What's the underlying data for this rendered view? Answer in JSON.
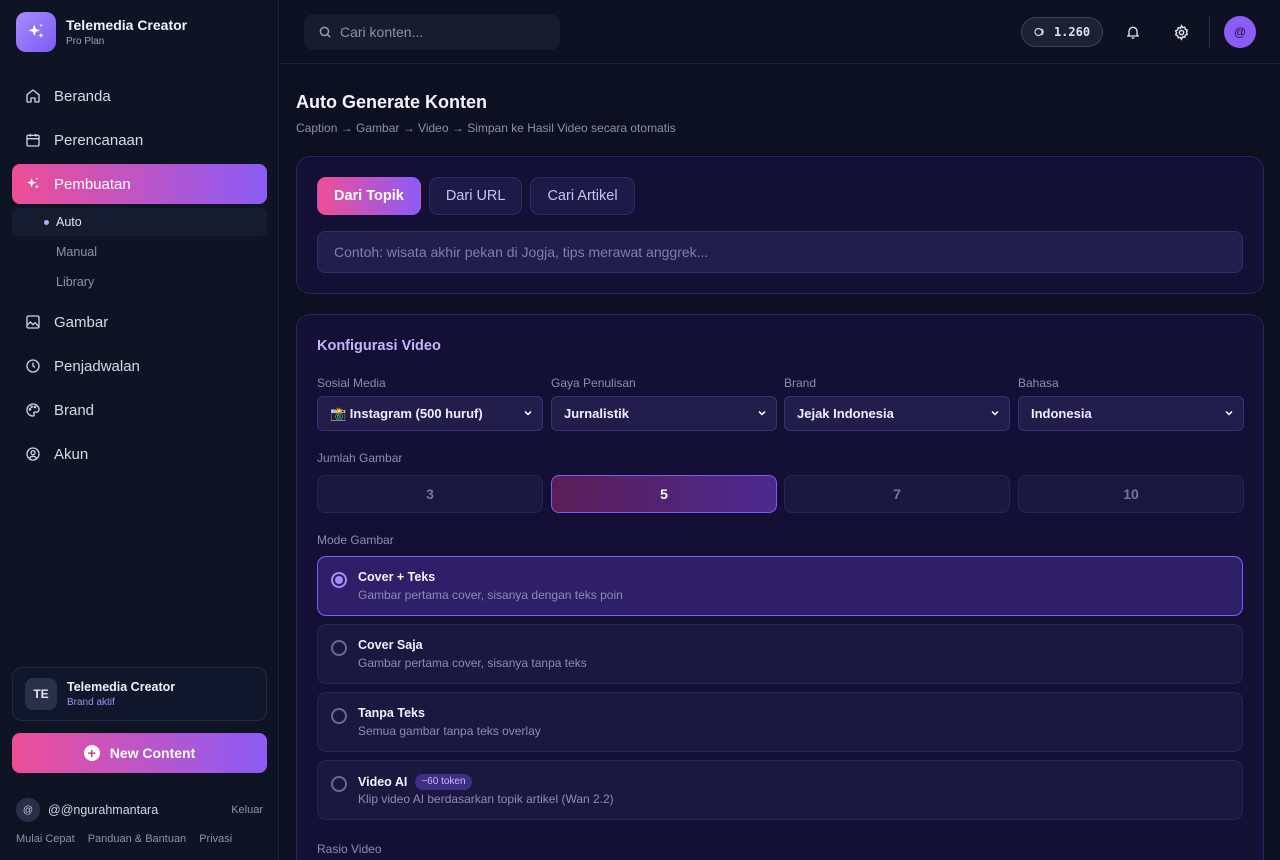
{
  "app": {
    "name": "Telemedia Creator",
    "plan": "Pro Plan"
  },
  "sidebar": {
    "items": [
      {
        "label": "Beranda",
        "icon": "home-icon"
      },
      {
        "label": "Perencanaan",
        "icon": "calendar-icon"
      },
      {
        "label": "Pembuatan",
        "icon": "sparkle-icon",
        "active": true
      },
      {
        "label": "Gambar",
        "icon": "image-icon"
      },
      {
        "label": "Penjadwalan",
        "icon": "clock-icon"
      },
      {
        "label": "Brand",
        "icon": "palette-icon"
      },
      {
        "label": "Akun",
        "icon": "user-circle-icon"
      }
    ],
    "sub_items": [
      {
        "label": "Auto",
        "active": true
      },
      {
        "label": "Manual"
      },
      {
        "label": "Library"
      }
    ],
    "brand_card": {
      "initials": "TE",
      "name": "Telemedia Creator",
      "status": "Brand aktif"
    },
    "new_content_label": "New Content",
    "user": {
      "avatar": "@",
      "handle": "@@ngurahmantara",
      "logout": "Keluar"
    },
    "footer_links": [
      "Mulai Cepat",
      "Panduan & Bantuan",
      "Privasi"
    ]
  },
  "topbar": {
    "search_placeholder": "Cari konten...",
    "tokens": "1.260",
    "user_avatar": "@"
  },
  "main": {
    "title": "Auto Generate Konten",
    "subtitle": "Caption → Gambar → Video → Simpan ke Hasil Video secara otomatis",
    "source_tabs": [
      {
        "label": "Dari Topik",
        "active": true
      },
      {
        "label": "Dari URL"
      },
      {
        "label": "Cari Artikel"
      }
    ],
    "topic_placeholder": "Contoh: wisata akhir pekan di Jogja, tips merawat anggrek...",
    "config": {
      "title": "Konfigurasi Video",
      "fields": [
        {
          "label": "Sosial Media",
          "value": "📸 Instagram (500 huruf)"
        },
        {
          "label": "Gaya Penulisan",
          "value": "Jurnalistik"
        },
        {
          "label": "Brand",
          "value": "Jejak Indonesia"
        },
        {
          "label": "Bahasa",
          "value": "Indonesia"
        }
      ],
      "image_count_label": "Jumlah Gambar",
      "image_counts": [
        {
          "label": "3"
        },
        {
          "label": "5",
          "active": true
        },
        {
          "label": "7"
        },
        {
          "label": "10"
        }
      ],
      "image_mode_label": "Mode Gambar",
      "image_modes": [
        {
          "title": "Cover + Teks",
          "desc": "Gambar pertama cover, sisanya dengan teks poin",
          "active": true
        },
        {
          "title": "Cover Saja",
          "desc": "Gambar pertama cover, sisanya tanpa teks"
        },
        {
          "title": "Tanpa Teks",
          "desc": "Semua gambar tanpa teks overlay"
        },
        {
          "title": "Video AI",
          "desc": "Klip video AI berdasarkan topik artikel (Wan 2.2)",
          "badge": "~60 token"
        }
      ],
      "ratio_label": "Rasio Video"
    }
  },
  "colors": {
    "accent_pink": "#ee4e96",
    "accent_purple": "#8b5cf6",
    "background": "#0c1020",
    "card": "#140f34"
  }
}
